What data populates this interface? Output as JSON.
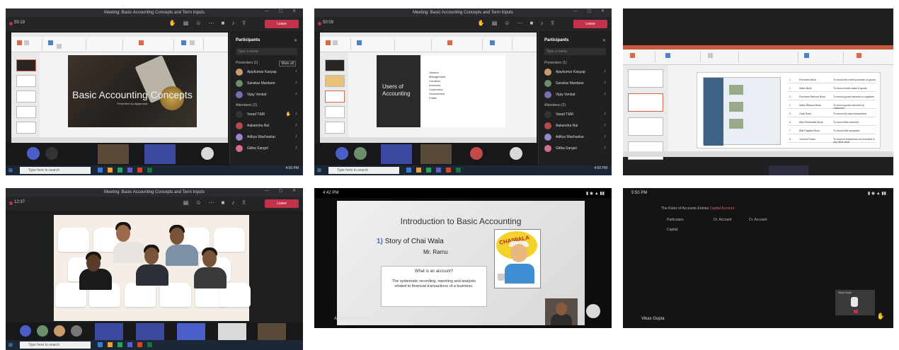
{
  "tiles": {
    "t1": {
      "window_title": "Meeting: Basic Accounting Concepts and Term Inputs",
      "timer": "55:19",
      "leave_label": "Leave",
      "panel_title": "Participants",
      "search_placeholder": "Type a name",
      "presenters_label": "Presenters (1)",
      "mute_all_label": "Mute all",
      "attendees_label": "Attendees (2)",
      "participants": [
        "Ajaykumar Kasyap",
        "Sanskar Mardarer",
        "Vijay Venkat",
        "Varad T&M",
        "Aakansha Rai",
        "Aditya Wachaskar",
        "Gitika Sangel"
      ],
      "slide_title": "Basic Accounting Concepts",
      "slide_subtitle": "Presented by Ajaykumar",
      "search_text": "Type here to search",
      "clock": "4:56 PM"
    },
    "t2": {
      "window_title": "Meeting: Basic Accounting Concepts and Term Inputs",
      "timer": "50:09",
      "leave_label": "Leave",
      "panel_title": "Participants",
      "search_placeholder": "Type a name",
      "presenters_label": "Presenters (1)",
      "attendees_label": "Attendees (2)",
      "participants": [
        "Ajaykumar Kasyap",
        "Sanskar Mardarer",
        "Vijay Venkat",
        "Varad T&M",
        "Aakansha Rai",
        "Aditya Wachaskar",
        "Gitika Sangel"
      ],
      "slide_left_text": "Users of Accounting",
      "slide_bullets": [
        "Owners",
        "Management",
        "Creditors",
        "Investors",
        "Customers",
        "Government",
        "Public"
      ],
      "search_text": "Type here to search",
      "clock": "4:50 PM"
    },
    "t3": {
      "rows": [
        {
          "no": "1",
          "name": "Purchase Book",
          "desc": "To record the credit purchase of goods"
        },
        {
          "no": "2",
          "name": "Sales Book",
          "desc": "To record credit sales of goods"
        },
        {
          "no": "3",
          "name": "Purchase Returns Book",
          "desc": "To record goods returned to suppliers"
        },
        {
          "no": "4",
          "name": "Sales Returns Book",
          "desc": "To record goods returned by customers"
        },
        {
          "no": "5",
          "name": "Cash Book",
          "desc": "To record all cash transactions"
        },
        {
          "no": "6",
          "name": "Bills Receivable Book",
          "desc": "To record bills received"
        },
        {
          "no": "7",
          "name": "Bills Payable Book",
          "desc": "To record bills accepted"
        },
        {
          "no": "8",
          "name": "Journal Proper",
          "desc": "To record transactions not recorded in any other book"
        }
      ]
    },
    "t4": {
      "window_title": "Meeting: Basic Accounting Concepts and Term Inputs",
      "timer": "12:37",
      "leave_label": "Leave",
      "search_text": "Type here to search"
    },
    "t5": {
      "status_time": "4:42 PM",
      "slide_title": "Introduction to Basic Accounting",
      "story_num": "1)",
      "story_text": "Story of Chai Wala",
      "story_name": "Mr. Ramu",
      "question": "What is an account?",
      "answer": "The systematic recording, reporting and analysis related to financial transactions of a business.",
      "image_label": "CHAIWALA",
      "presenter_name": "Ajaykumar Kasyap"
    },
    "t6": {
      "status_time": "5:50 PM",
      "heading": "The Rules of Accounts Entries",
      "heading_link": "Capital Account",
      "col_particulars": "Particulars",
      "col_dr": "Dr. Account",
      "col_cr": "Cr. Account",
      "row1": "Capital",
      "presenter_name": "Vikas Gupta",
      "subcard_label": "Vikas Gupta"
    }
  },
  "colors": {
    "teams_leave": "#c4314b",
    "teams_dark": "#202022",
    "ppt_accent": "#d56b4c",
    "hand_raise": "#f2b531"
  }
}
